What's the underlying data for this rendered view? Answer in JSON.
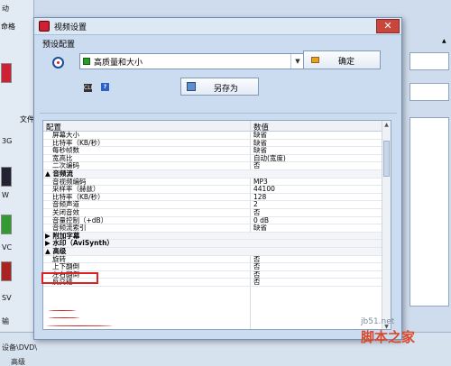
{
  "background": {
    "left_labels": [
      "动",
      "3G",
      "W",
      "VC",
      "SV",
      "输"
    ],
    "top_label": "命格",
    "bottom_left": "设备\\DVD\\",
    "bottom_left2": "高级",
    "list_header": "文件",
    "right_field": "▲"
  },
  "dialog": {
    "title": "视频设置",
    "close": "✕",
    "preset_label": "预设配置",
    "preset_value": "高质量和大小",
    "ok_label": "确定",
    "saveas_label": "另存为",
    "cli_icon": "CLI",
    "help_icon": "?"
  },
  "grid": {
    "header_name": "配置",
    "header_value": "数值",
    "rows": [
      {
        "n": "屏幕大小",
        "v": "缺省",
        "cat": false
      },
      {
        "n": "比特率（KB/秒）",
        "v": "缺省",
        "cat": false
      },
      {
        "n": "每秒帧数",
        "v": "缺省",
        "cat": false
      },
      {
        "n": "宽高比",
        "v": "自动(宽度)",
        "cat": false
      },
      {
        "n": "二次编码",
        "v": "否",
        "cat": false
      },
      {
        "n": "▲ 音频流",
        "v": "",
        "cat": true
      },
      {
        "n": "音视频编码",
        "v": "MP3",
        "cat": false
      },
      {
        "n": "采样率（赫兹）",
        "v": "44100",
        "cat": false
      },
      {
        "n": "比特率（KB/秒）",
        "v": "128",
        "cat": false
      },
      {
        "n": "音频声道",
        "v": "2",
        "cat": false
      },
      {
        "n": "关闭音效",
        "v": "否",
        "cat": false
      },
      {
        "n": "音量控制（+dB）",
        "v": "0 dB",
        "cat": false
      },
      {
        "n": "音频流索引",
        "v": "缺省",
        "cat": false
      },
      {
        "n": "▶ 附加字幕",
        "v": "",
        "cat": true
      },
      {
        "n": "▶ 水印（AviSynth）",
        "v": "",
        "cat": true
      },
      {
        "n": "▲ 高级",
        "v": "",
        "cat": true
      },
      {
        "n": "旋转",
        "v": "否",
        "cat": false
      },
      {
        "n": "上下翻倒",
        "v": "否",
        "cat": false
      },
      {
        "n": "左右翻倒",
        "v": "否",
        "cat": false
      },
      {
        "n": "反交错",
        "v": "否",
        "cat": false
      }
    ]
  },
  "watermark": {
    "site": "jb51.net",
    "brand": "脚本之家"
  },
  "colors": {
    "highlight": "#e02020",
    "dialog_bg": "#ccdcf0",
    "close_red": "#c9463d"
  }
}
